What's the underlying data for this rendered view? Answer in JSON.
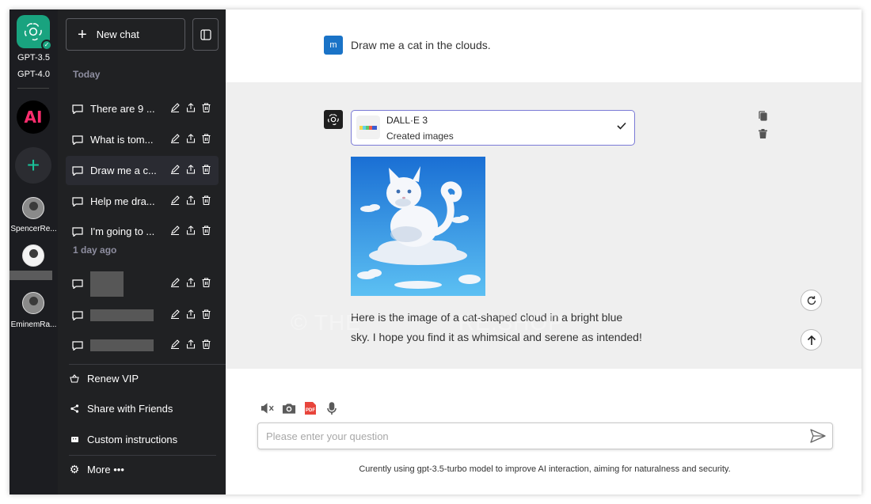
{
  "rail": {
    "models": [
      "GPT-3.5",
      "GPT-4.0"
    ],
    "ai_logo_text": "AI",
    "users": [
      "SpencerRe...",
      "",
      "EminemRa..."
    ]
  },
  "sidebar": {
    "new_chat": "New chat",
    "sections": [
      {
        "label": "Today",
        "items": [
          "There are 9 ...",
          "What is tom...",
          "Draw me a c...",
          "Help me dra...",
          "I'm going to ..."
        ],
        "active_index": 2
      },
      {
        "label": "1 day ago",
        "items": [
          "",
          "",
          ""
        ]
      }
    ],
    "menu": {
      "renew_vip": "Renew VIP",
      "share": "Share with Friends",
      "custom_instructions": "Custom instructions",
      "more": "More •••"
    }
  },
  "chat": {
    "user_avatar_letter": "m",
    "user_message": "Draw me a cat in the clouds.",
    "tool_card": {
      "title": "DALL·E 3",
      "subtitle": "Created images"
    },
    "assistant_message": "Here is the image of a cat-shaped cloud in a bright blue sky. I hope you find it as whimsical and serene as intended!",
    "watermark": "© THE              RE.SHOP"
  },
  "composer": {
    "placeholder": "Please enter your question",
    "footnote": "Curently using gpt-3.5-turbo model to improve AI interaction, aiming for naturalness and security."
  },
  "colors": {
    "brand_green": "#19a37f",
    "sidebar_bg": "#202123",
    "rail_bg": "#1c1d21",
    "user_avatar": "#1a73c7",
    "ai_pink": "#ff2d6e",
    "card_border": "#7a7ad6"
  }
}
